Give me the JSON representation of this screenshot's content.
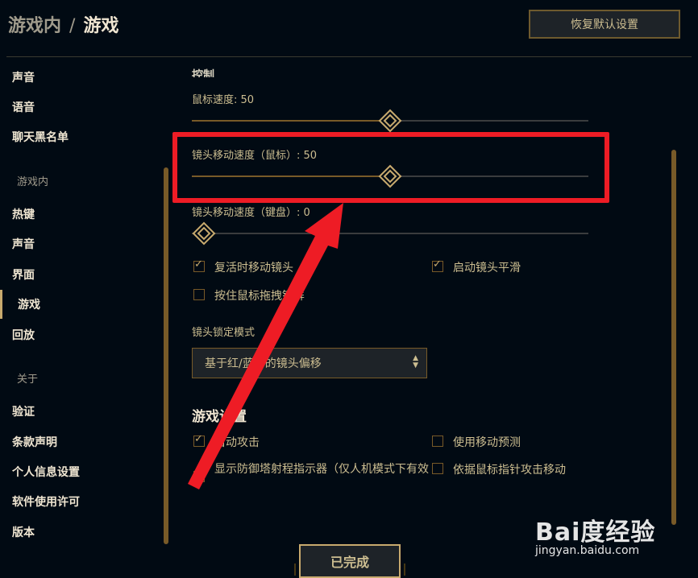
{
  "header": {
    "breadcrumb_parent": "游戏内",
    "breadcrumb_separator": "/",
    "breadcrumb_current": "游戏",
    "reset_button": "恢复默认设置"
  },
  "sidebar": {
    "items_top": [
      "声音",
      "语音",
      "聊天黑名单"
    ],
    "section_ingame": "游戏内",
    "items_ingame": [
      "热键",
      "声音",
      "界面",
      "游戏",
      "回放"
    ],
    "active_item": "游戏",
    "section_about": "关于",
    "items_about": [
      "验证",
      "条款声明",
      "个人信息设置",
      "软件使用许可",
      "版本"
    ]
  },
  "controls": {
    "cut_header": "控制",
    "mouse_speed": {
      "label": "鼠标速度: 50",
      "value": 50
    },
    "camera_speed_mouse": {
      "label": "镜头移动速度（鼠标）: 50",
      "value": 50
    },
    "camera_speed_keyboard": {
      "label": "镜头移动速度（键盘）: 0",
      "value": 0
    },
    "checkboxes": [
      {
        "label": "复活时移动镜头",
        "checked": true
      },
      {
        "label": "启动镜头平滑",
        "checked": true
      },
      {
        "label": "按住鼠标拖拽锁屏",
        "checked": false
      }
    ],
    "camera_lock_label": "镜头锁定模式",
    "camera_lock_value": "基于红/蓝方的镜头偏移"
  },
  "gameplay": {
    "title": "游戏设置",
    "checkboxes": [
      {
        "label": "自动攻击",
        "checked": true
      },
      {
        "label": "使用移动预测",
        "checked": false
      },
      {
        "label": "显示防御塔射程指示器（仅人机模式下有效",
        "checked": true
      },
      {
        "label": "依据鼠标指针攻击移动",
        "checked": false
      }
    ]
  },
  "footer": {
    "done_button": "已完成"
  },
  "watermark": {
    "brand": "Bai度经验",
    "url": "jingyan.baidu.com"
  },
  "colors": {
    "background": "#010a13",
    "gold": "#c8aa6e",
    "text": "#cdbe91",
    "highlight": "#ee1c25"
  }
}
